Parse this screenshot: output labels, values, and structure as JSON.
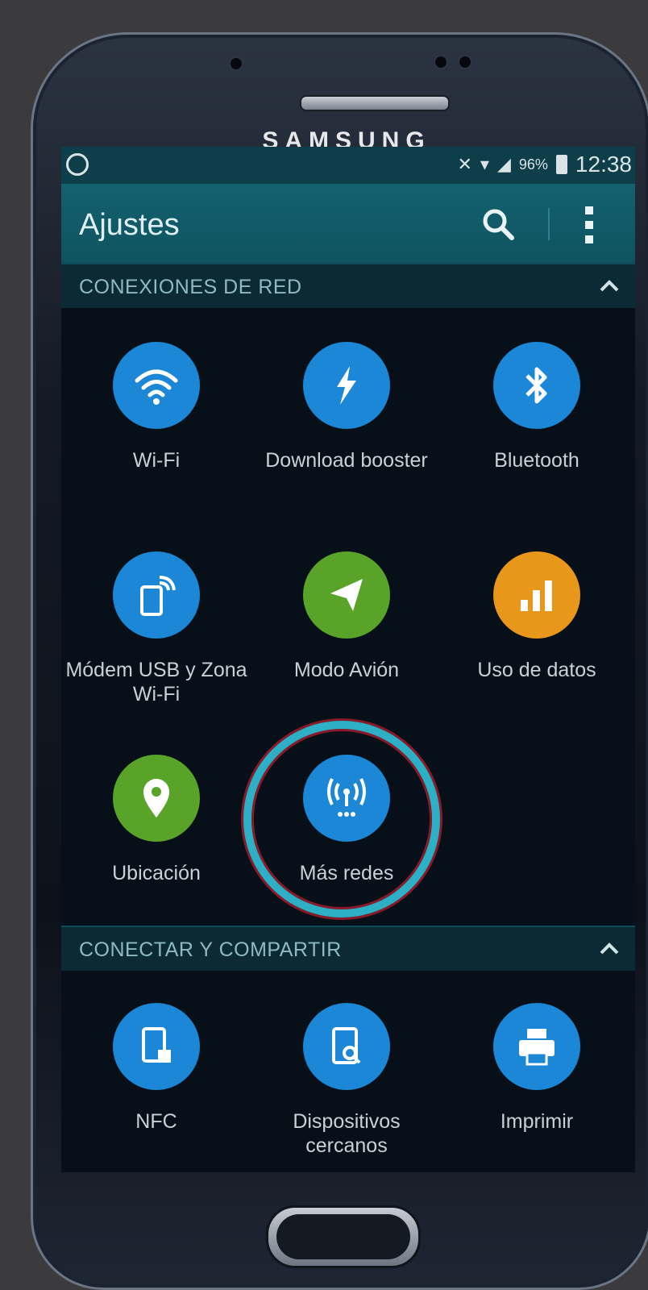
{
  "device": {
    "brand": "SAMSUNG"
  },
  "status_bar": {
    "time": "12:38",
    "battery": "96%"
  },
  "action_bar": {
    "title": "Ajustes",
    "search_icon": "search-icon",
    "overflow_icon": "more-vert-icon"
  },
  "sections": [
    {
      "label": "CONEXIONES DE RED",
      "items": [
        {
          "label": "Wi-Fi",
          "icon": "wifi-icon",
          "color": "#1b87d6"
        },
        {
          "label": "Download booster",
          "icon": "download-booster-icon",
          "color": "#1b87d6"
        },
        {
          "label": "Bluetooth",
          "icon": "bluetooth-icon",
          "color": "#1b87d6"
        },
        {
          "label": "Módem USB y Zona Wi-Fi",
          "icon": "hotspot-icon",
          "color": "#1b87d6"
        },
        {
          "label": "Modo Avión",
          "icon": "airplane-icon",
          "color": "#5aa329"
        },
        {
          "label": "Uso de datos",
          "icon": "data-usage-icon",
          "color": "#e8971b"
        },
        {
          "label": "Ubicación",
          "icon": "location-icon",
          "color": "#5aa329"
        },
        {
          "label": "Más redes",
          "icon": "more-networks-icon",
          "color": "#1b87d6",
          "highlighted": true
        }
      ]
    },
    {
      "label": "CONECTAR Y COMPARTIR",
      "items": [
        {
          "label": "NFC",
          "icon": "nfc-icon",
          "color": "#1b87d6"
        },
        {
          "label": "Dispositivos cercanos",
          "icon": "nearby-devices-icon",
          "color": "#1b87d6"
        },
        {
          "label": "Imprimir",
          "icon": "print-icon",
          "color": "#1b87d6"
        }
      ]
    }
  ]
}
